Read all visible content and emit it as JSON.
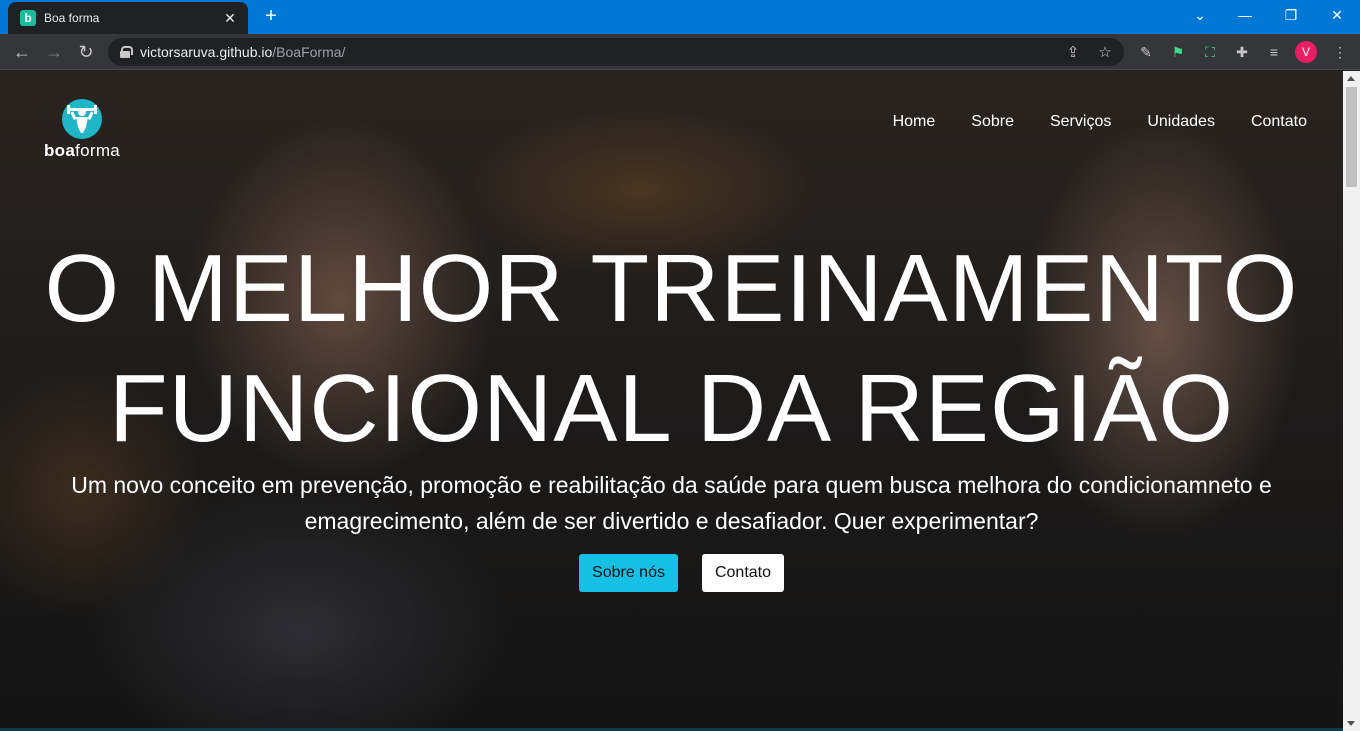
{
  "browser": {
    "tab_title": "Boa forma",
    "favicon_letter": "b",
    "new_tab": "+",
    "url_host": "victorsaruva.github.io",
    "url_path": "/BoaForma/",
    "profile_initial": "V"
  },
  "site": {
    "logo": {
      "bold": "boa",
      "regular": "forma"
    },
    "nav": [
      "Home",
      "Sobre",
      "Serviços",
      "Unidades",
      "Contato"
    ],
    "headline_line1": "O MELHOR TREINAMENTO",
    "headline_line2": "FUNCIONAL DA REGIÃO",
    "subtitle": "Um novo conceito em prevenção, promoção e reabilitação da saúde para quem busca melhora do condicionamneto e emagrecimento, além de ser divertido e desafiador. Quer experimentar?",
    "btn_primary": "Sobre nós",
    "btn_secondary": "Contato"
  },
  "colors": {
    "tabbar": "#0078d4",
    "accent": "#16c0e5",
    "logo": "#1fb6c8"
  }
}
